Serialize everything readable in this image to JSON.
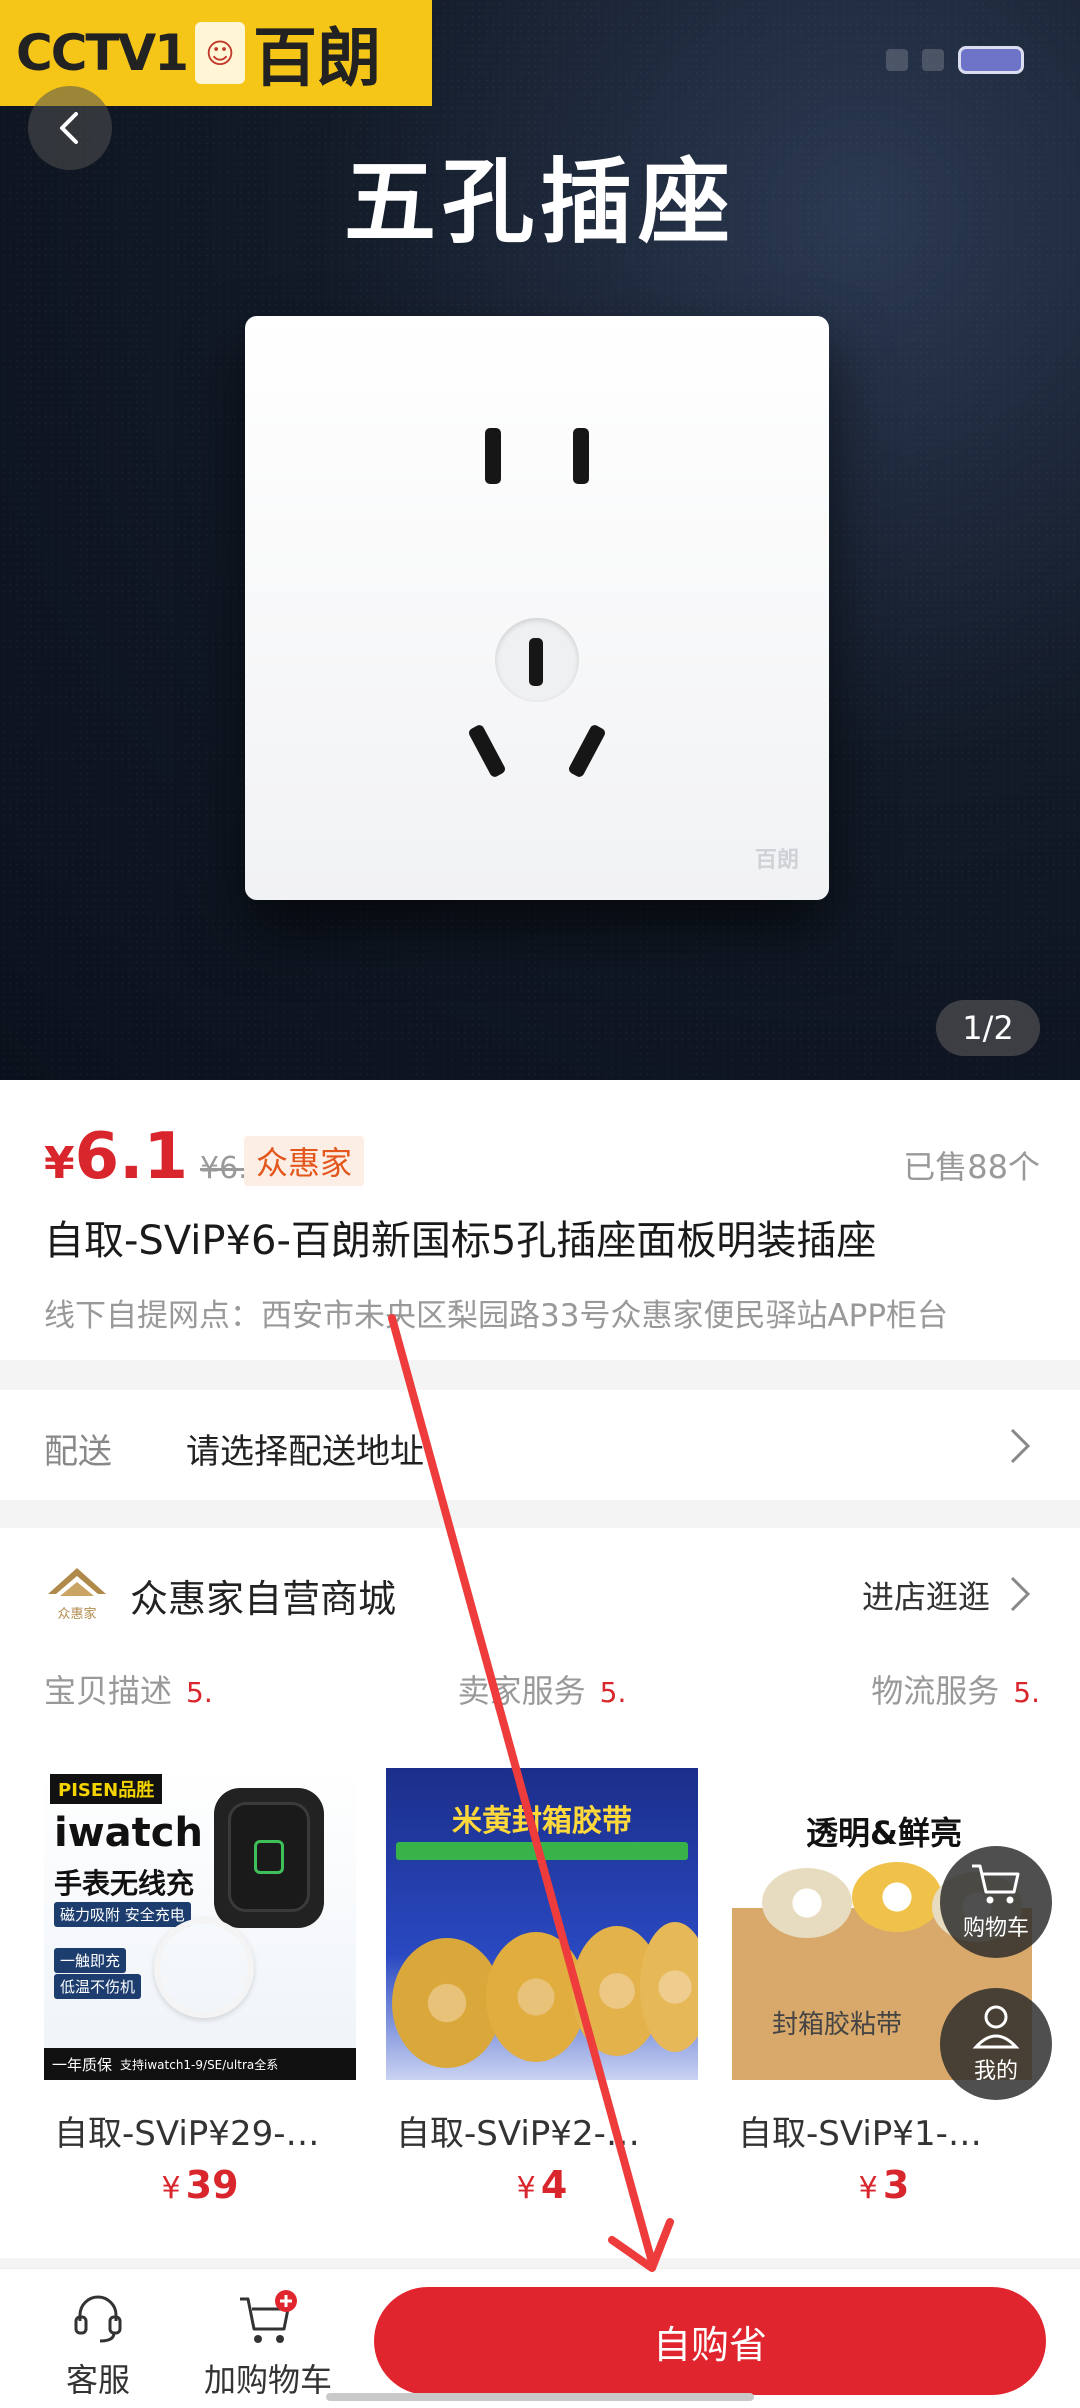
{
  "watermark": {
    "channel": "CCTV1",
    "brand": "百朗"
  },
  "hero": {
    "title": "五孔插座",
    "pager": "1/2",
    "socket_logo": "百朗"
  },
  "product": {
    "currency": "¥",
    "price": "6.1",
    "original_price": "¥6.2",
    "store_tag": "众惠家",
    "sold": "已售88个",
    "title": "自取-SViP¥6-百朗新国标5孔插座面板明装插座",
    "pickup": "线下自提网点：西安市未央区梨园路33号众惠家便民驿站APP柜台"
  },
  "delivery": {
    "label": "配送",
    "value": "请选择配送地址"
  },
  "shop": {
    "name": "众惠家自营商城",
    "enter": "进店逛逛",
    "ratings": [
      {
        "label": "宝贝描述",
        "value": "5."
      },
      {
        "label": "卖家服务",
        "value": "5."
      },
      {
        "label": "物流服务",
        "value": "5."
      }
    ],
    "products": [
      {
        "name": "自取-SViP¥29-…",
        "currency": "¥",
        "price": "39",
        "img_title": "iwatch",
        "img_sub": "手表无线充",
        "img_brand": "PISEN品胜",
        "img_tag1": "磁力吸附 安全充电",
        "img_tag2": "一触即充",
        "img_tag3": "低温不伤机",
        "img_foot": "一年质保",
        "img_foot2": "支持iwatch1-9/SE/ultra全系"
      },
      {
        "name": "自取-SViP¥2-…",
        "currency": "¥",
        "price": "4",
        "img_title": "米黄封箱胶带"
      },
      {
        "name": "自取-SViP¥1-…",
        "currency": "¥",
        "price": "3",
        "img_title": "透明&鲜亮",
        "img_box": "封箱胶粘带"
      }
    ]
  },
  "fabs": {
    "cart": "购物车",
    "me": "我的"
  },
  "bottom": {
    "service": "客服",
    "add_cart": "加购物车",
    "buy": "自购省"
  }
}
